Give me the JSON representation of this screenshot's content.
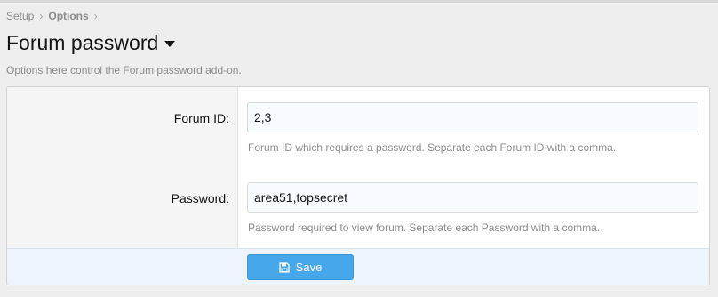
{
  "breadcrumb": {
    "items": [
      "Setup",
      "Options"
    ],
    "separator": "›"
  },
  "header": {
    "title": "Forum password",
    "title_icon": "caret-down-icon",
    "description": "Options here control the Forum password add-on."
  },
  "form": {
    "fields": [
      {
        "label": "Forum ID:",
        "value": "2,3",
        "hint": "Forum ID which requires a password. Separate each Forum ID with a comma."
      },
      {
        "label": "Password:",
        "value": "area51,topsecret",
        "hint": "Password required to view forum. Separate each Password with a comma."
      }
    ],
    "save_label": "Save",
    "save_icon": "floppy-disk-icon"
  },
  "colors": {
    "accent": "#47a7eb",
    "footer_bg": "#edf4fc",
    "label_col_bg": "#f5f5f5",
    "muted_text": "#8c8c8c"
  }
}
